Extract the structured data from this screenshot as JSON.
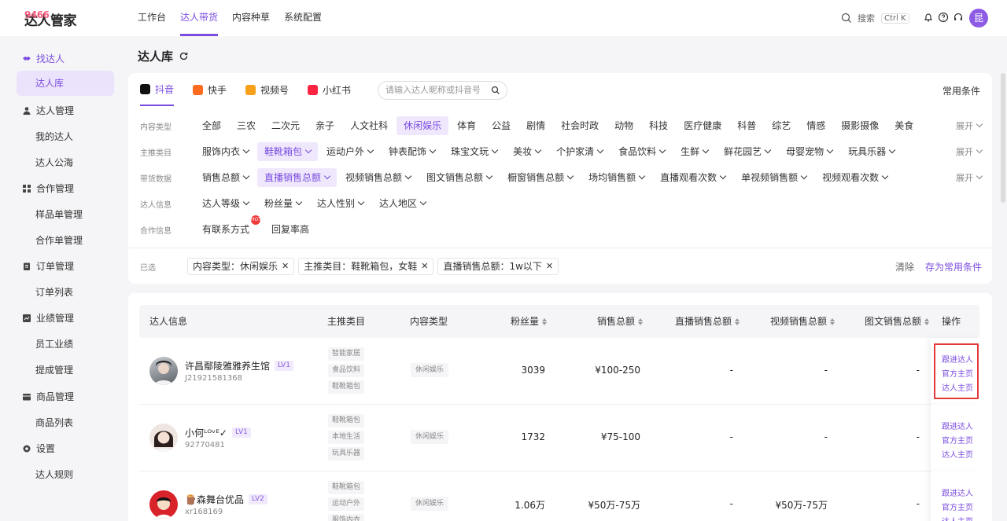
{
  "app": {
    "logo_num": "9466",
    "logo_text": "达人管家"
  },
  "topnav": [
    "工作台",
    "达人带货",
    "内容种草",
    "系统配置"
  ],
  "search": {
    "label": "搜索",
    "shortcut": "Ctrl K"
  },
  "user": {
    "avatar_char": "昆"
  },
  "sidebar": {
    "g1": "找达人",
    "g1_items": [
      "达人库"
    ],
    "g2": "达人管理",
    "g2_items": [
      "我的达人",
      "达人公海"
    ],
    "g3": "合作管理",
    "g3_items": [
      "样品单管理",
      "合作单管理"
    ],
    "g4": "订单管理",
    "g4_items": [
      "订单列表"
    ],
    "g5": "业绩管理",
    "g5_items": [
      "员工业绩",
      "提成管理"
    ],
    "g6": "商品管理",
    "g6_items": [
      "商品列表"
    ],
    "g7": "设置",
    "g7_items": [
      "达人规则"
    ]
  },
  "page": {
    "title": "达人库"
  },
  "platforms": [
    "抖音",
    "快手",
    "视频号",
    "小红书"
  ],
  "keyword": {
    "placeholder": "请输入达人昵称或抖音号"
  },
  "common_conditions": "常用条件",
  "filters": {
    "content_type": {
      "label": "内容类型",
      "options": [
        "全部",
        "三农",
        "二次元",
        "亲子",
        "人文社科",
        "休闲娱乐",
        "体育",
        "公益",
        "剧情",
        "社会时政",
        "动物",
        "科技",
        "医疗健康",
        "科普",
        "综艺",
        "情感",
        "摄影摄像",
        "美食"
      ],
      "expand": "展开"
    },
    "main_category": {
      "label": "主推类目",
      "options": [
        "服饰内衣",
        "鞋靴箱包",
        "运动户外",
        "钟表配饰",
        "珠宝文玩",
        "美妆",
        "个护家清",
        "食品饮料",
        "生鲜",
        "鲜花园艺",
        "母婴宠物",
        "玩具乐器"
      ],
      "expand": "展开"
    },
    "sales_data": {
      "label": "带货数据",
      "options": [
        "销售总额",
        "直播销售总额",
        "视频销售总额",
        "图文销售总额",
        "橱窗销售总额",
        "场均销售额",
        "直播观看次数",
        "单视频销售额",
        "视频观看次数"
      ],
      "expand": "展开"
    },
    "talent_info": {
      "label": "达人信息",
      "options": [
        "达人等级",
        "粉丝量",
        "达人性别",
        "达人地区"
      ]
    },
    "coop_info": {
      "label": "合作信息",
      "options": [
        "有联系方式",
        "回复率高"
      ],
      "hot_badge": "HOT"
    }
  },
  "selected": {
    "label": "已选",
    "tags": [
      "内容类型：休闲娱乐",
      "主推类目：鞋靴箱包，女鞋",
      "直播销售总额：1w以下"
    ],
    "clear": "清除",
    "save": "存为常用条件"
  },
  "table": {
    "headers": [
      "达人信息",
      "主推类目",
      "内容类型",
      "粉丝量",
      "销售总额",
      "直播销售总额",
      "视频销售总额",
      "图文销售总额",
      "操作"
    ],
    "rows": [
      {
        "name": "许昌鄢陵雅雅养生馆",
        "level": "LV1",
        "id": "J21921581368",
        "categories": [
          "智能家居",
          "食品饮料",
          "鞋靴箱包"
        ],
        "content_type": "休闲娱乐",
        "fans": "3039",
        "sales": "¥100-250",
        "live_sales": "-",
        "video_sales": "-",
        "text_sales": "-"
      },
      {
        "name": "小何ᴸᴼᵛᴱ✓",
        "level": "LV1",
        "id": "92770481",
        "categories": [
          "鞋靴箱包",
          "本地生活",
          "玩具乐器"
        ],
        "content_type": "休闲娱乐",
        "fans": "1732",
        "sales": "¥75-100",
        "live_sales": "-",
        "video_sales": "-",
        "text_sales": "-"
      },
      {
        "name": "🪵森舞台优品",
        "level": "LV2",
        "id": "xr168169",
        "categories": [
          "鞋靴箱包",
          "运动户外",
          "服饰内衣"
        ],
        "content_type": "休闲娱乐",
        "fans": "1.06万",
        "sales": "¥50万-75万",
        "live_sales": "-",
        "video_sales": "¥50万-75万",
        "text_sales": "-"
      }
    ],
    "ops": [
      "跟进达人",
      "官方主页",
      "达人主页"
    ]
  },
  "colors": {
    "accent": "#7b4ce0",
    "accent_bg": "#efe8fc",
    "highlight_frame": "#e23a3a"
  }
}
